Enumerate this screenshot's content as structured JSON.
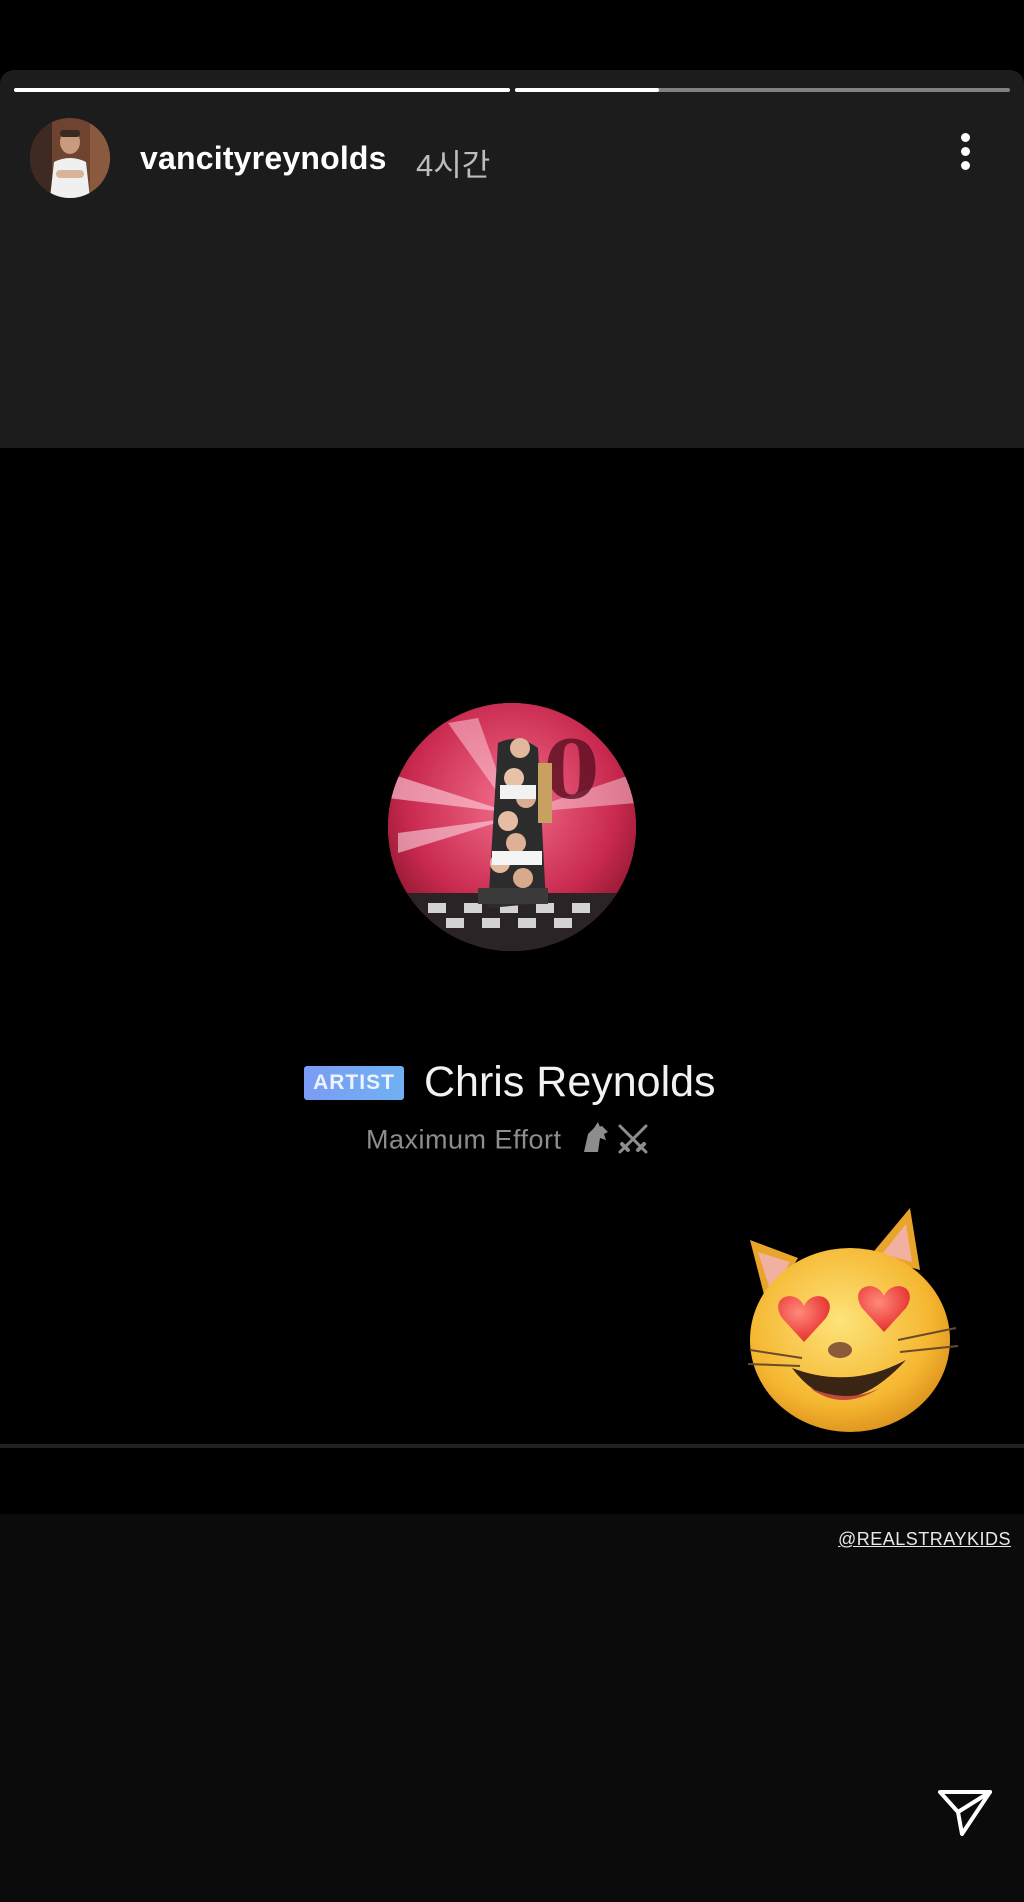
{
  "story": {
    "username": "vancityreynolds",
    "time_ago": "4시간",
    "progress": [
      1.0,
      0.29
    ]
  },
  "profile": {
    "badge": "ARTIST",
    "name": "Chris Reynolds",
    "bio": "Maximum Effort",
    "bio_icons": [
      "horse-icon",
      "crossed-swords-icon"
    ]
  },
  "sticker": {
    "mention": "@REALSTRAYKIDS"
  },
  "icons": {
    "more": "more-vertical-icon",
    "send": "send-icon",
    "emoji": "smiling-cat-heart-eyes-emoji"
  },
  "colors": {
    "badge_start": "#7b9cf5",
    "badge_end": "#6fb1f2",
    "header_bg": "#1c1c1c"
  }
}
